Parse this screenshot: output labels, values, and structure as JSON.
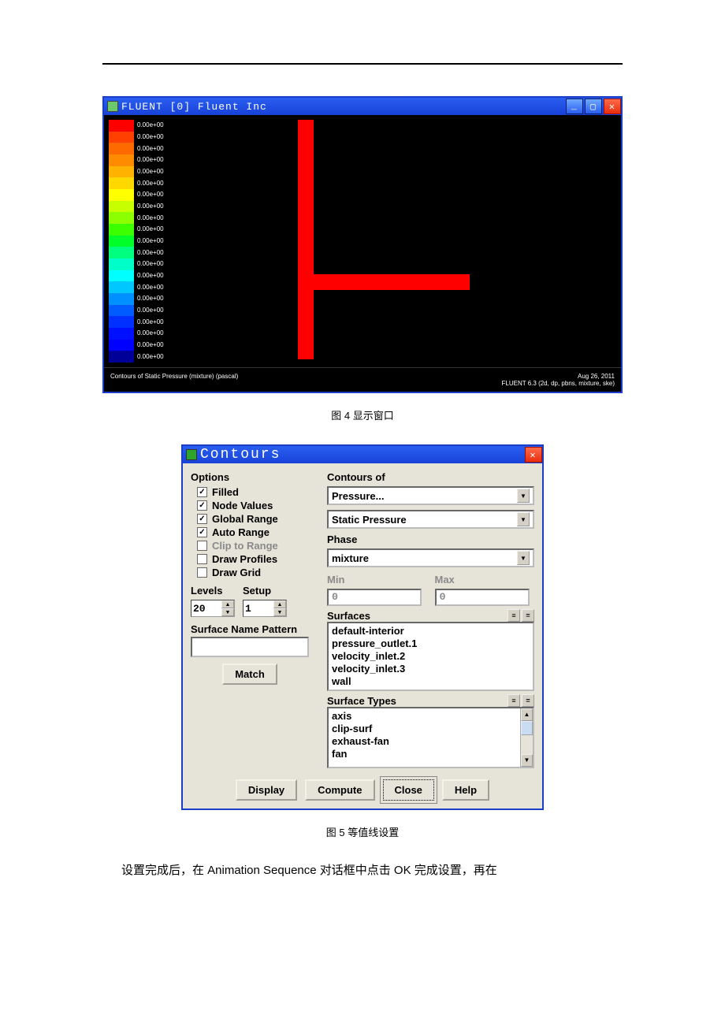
{
  "fluent_window": {
    "title": "FLUENT [0] Fluent Inc",
    "colorbar": {
      "colors": [
        "#ff0000",
        "#ff4000",
        "#ff6a00",
        "#ff8c00",
        "#ffb300",
        "#ffd800",
        "#ffff00",
        "#c8ff00",
        "#8cff00",
        "#3cff00",
        "#00ff28",
        "#00ff7e",
        "#00ffc8",
        "#00ffff",
        "#00c8ff",
        "#0090ff",
        "#005cff",
        "#0030ff",
        "#0010ff",
        "#0000ff",
        "#000099"
      ],
      "labels": [
        "0.00e+00",
        "0.00e+00",
        "0.00e+00",
        "0.00e+00",
        "0.00e+00",
        "0.00e+00",
        "0.00e+00",
        "0.00e+00",
        "0.00e+00",
        "0.00e+00",
        "0.00e+00",
        "0.00e+00",
        "0.00e+00",
        "0.00e+00",
        "0.00e+00",
        "0.00e+00",
        "0.00e+00",
        "0.00e+00",
        "0.00e+00",
        "0.00e+00",
        "0.00e+00"
      ]
    },
    "footer_left": "Contours of Static Pressure (mixture)  (pascal)",
    "footer_right1": "Aug 26, 2011",
    "footer_right2": "FLUENT 6.3 (2d, dp, pbns, mixture, ske)"
  },
  "caption_fig4": "图 4  显示窗口",
  "contours_dialog": {
    "title": "Contours",
    "options_label": "Options",
    "options": {
      "filled": {
        "label": "Filled",
        "checked": true,
        "enabled": true
      },
      "node_values": {
        "label": "Node Values",
        "checked": true,
        "enabled": true
      },
      "global_range": {
        "label": "Global Range",
        "checked": true,
        "enabled": true
      },
      "auto_range": {
        "label": "Auto Range",
        "checked": true,
        "enabled": true
      },
      "clip_to_range": {
        "label": "Clip to Range",
        "checked": false,
        "enabled": false
      },
      "draw_profiles": {
        "label": "Draw Profiles",
        "checked": false,
        "enabled": true
      },
      "draw_grid": {
        "label": "Draw Grid",
        "checked": false,
        "enabled": true
      }
    },
    "levels_label": "Levels",
    "setup_label": "Setup",
    "levels_value": "20",
    "setup_value": "1",
    "surface_name_pattern_label": "Surface Name Pattern",
    "surface_name_pattern_value": "",
    "match_btn": "Match",
    "contours_of_label": "Contours of",
    "contours_of_primary": "Pressure...",
    "contours_of_secondary": "Static Pressure",
    "phase_label": "Phase",
    "phase_value": "mixture",
    "min_label": "Min",
    "max_label": "Max",
    "min_value": "0",
    "max_value": "0",
    "surfaces_label": "Surfaces",
    "surfaces": [
      "default-interior",
      "pressure_outlet.1",
      "velocity_inlet.2",
      "velocity_inlet.3",
      "wall"
    ],
    "surface_types_label": "Surface Types",
    "surface_types": [
      "axis",
      "clip-surf",
      "exhaust-fan",
      "fan"
    ],
    "btn_display": "Display",
    "btn_compute": "Compute",
    "btn_close": "Close",
    "btn_help": "Help"
  },
  "caption_fig5": "图 5  等值线设置",
  "body_text": "设置完成后，在 Animation Sequence 对话框中点击 OK 完成设置，再在"
}
